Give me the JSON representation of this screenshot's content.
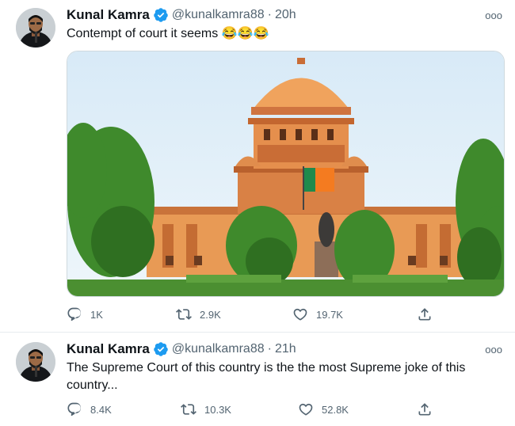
{
  "tweets": [
    {
      "name": "Kunal Kamra",
      "handle": "@kunalkamra88",
      "separator": "·",
      "time": "20h",
      "text": "Contempt of court it seems",
      "emoji": "😂😂😂",
      "has_image": true,
      "actions": {
        "replies": "1K",
        "retweets": "2.9K",
        "likes": "19.7K"
      }
    },
    {
      "name": "Kunal Kamra",
      "handle": "@kunalkamra88",
      "separator": "·",
      "time": "21h",
      "text": "The Supreme Court of this country is the the most Supreme joke of this country...",
      "actions": {
        "replies": "8.4K",
        "retweets": "10.3K",
        "likes": "52.8K"
      }
    }
  ],
  "more_glyph": "ooo",
  "colors": {
    "verified": "#1d9bf0",
    "muted": "#536471",
    "text": "#0f1419"
  },
  "icons": [
    "reply-icon",
    "retweet-icon",
    "like-icon",
    "share-icon",
    "verified-icon",
    "more-icon"
  ]
}
